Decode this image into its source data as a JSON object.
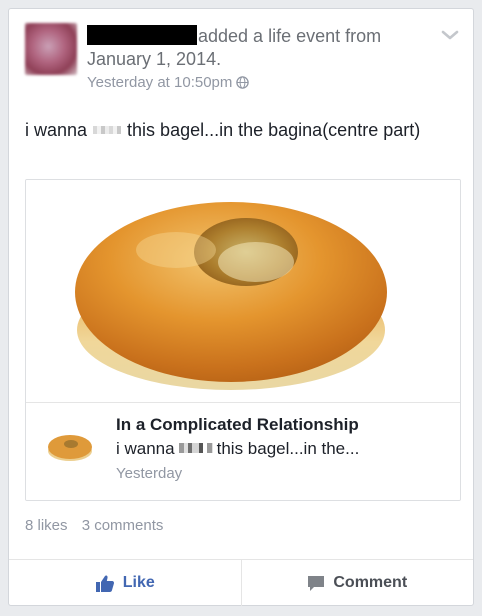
{
  "post": {
    "author_redacted": true,
    "header_text": "added a life event from January 1, 2014.",
    "timestamp": "Yesterday at 10:50pm",
    "privacy_icon": "globe-icon",
    "text_before": "i wanna",
    "text_after": "this bagel...in the bagina(centre part)"
  },
  "attachment": {
    "title": "In a Complicated Relationship",
    "desc_before": "i wanna",
    "desc_after": "this bagel...in the...",
    "time": "Yesterday"
  },
  "stats": {
    "likes": "8 likes",
    "comments": "3 comments"
  },
  "actions": {
    "like_label": "Like",
    "comment_label": "Comment"
  },
  "colors": {
    "accent": "#4267b2",
    "meta": "#9197a3",
    "text": "#1d2129"
  }
}
